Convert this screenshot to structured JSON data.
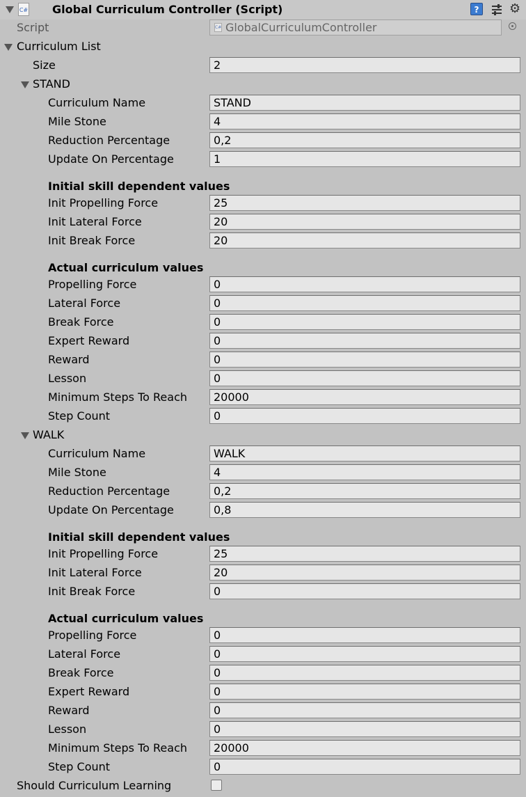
{
  "header": {
    "title": "Global Curriculum Controller (Script)",
    "script_icon_text": "C#",
    "help_icon_text": "?",
    "script_label": "Script",
    "script_value": "GlobalCurriculumController"
  },
  "curriculum_list": {
    "label": "Curriculum List",
    "size_label": "Size",
    "size_value": "2",
    "elements": [
      {
        "header": "STAND",
        "basic": [
          {
            "label": "Curriculum Name",
            "value": "STAND"
          },
          {
            "label": "Mile Stone",
            "value": "4"
          },
          {
            "label": "Reduction Percentage",
            "value": "0,2"
          },
          {
            "label": "Update On Percentage",
            "value": "1"
          }
        ],
        "initial_heading": "Initial skill dependent values",
        "initial": [
          {
            "label": "Init Propelling Force",
            "value": "25"
          },
          {
            "label": "Init Lateral Force",
            "value": "20"
          },
          {
            "label": "Init Break Force",
            "value": "20"
          }
        ],
        "actual_heading": "Actual curriculum values",
        "actual": [
          {
            "label": "Propelling Force",
            "value": "0"
          },
          {
            "label": "Lateral Force",
            "value": "0"
          },
          {
            "label": "Break Force",
            "value": "0"
          },
          {
            "label": "Expert Reward",
            "value": "0"
          },
          {
            "label": "Reward",
            "value": "0"
          },
          {
            "label": "Lesson",
            "value": "0"
          },
          {
            "label": "Minimum Steps To Reach",
            "value": "20000"
          },
          {
            "label": "Step Count",
            "value": "0"
          }
        ]
      },
      {
        "header": "WALK",
        "basic": [
          {
            "label": "Curriculum Name",
            "value": "WALK"
          },
          {
            "label": "Mile Stone",
            "value": "4"
          },
          {
            "label": "Reduction Percentage",
            "value": "0,2"
          },
          {
            "label": "Update On Percentage",
            "value": "0,8"
          }
        ],
        "initial_heading": "Initial skill dependent values",
        "initial": [
          {
            "label": "Init Propelling Force",
            "value": "25"
          },
          {
            "label": "Init Lateral Force",
            "value": "20"
          },
          {
            "label": "Init Break Force",
            "value": "0"
          }
        ],
        "actual_heading": "Actual curriculum values",
        "actual": [
          {
            "label": "Propelling Force",
            "value": "0"
          },
          {
            "label": "Lateral Force",
            "value": "0"
          },
          {
            "label": "Break Force",
            "value": "0"
          },
          {
            "label": "Expert Reward",
            "value": "0"
          },
          {
            "label": "Reward",
            "value": "0"
          },
          {
            "label": "Lesson",
            "value": "0"
          },
          {
            "label": "Minimum Steps To Reach",
            "value": "20000"
          },
          {
            "label": "Step Count",
            "value": "0"
          }
        ]
      }
    ]
  },
  "should_learning": {
    "label": "Should Curriculum Learning",
    "checked": false
  }
}
